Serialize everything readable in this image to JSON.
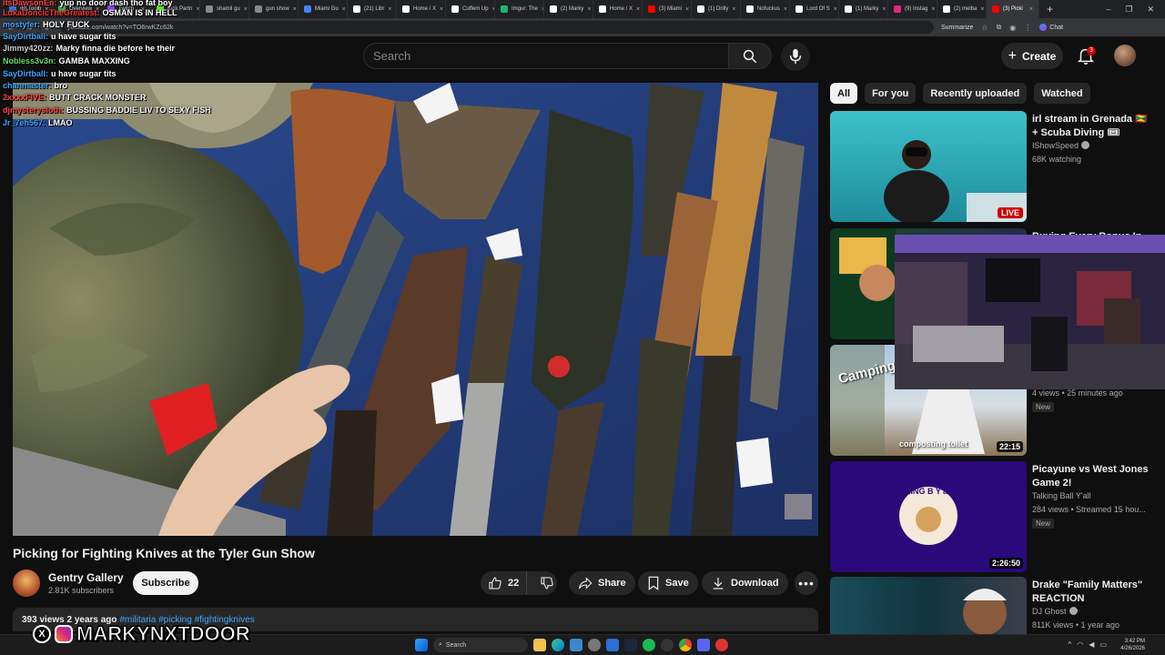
{
  "browser": {
    "tabs": [
      {
        "label": "IRLToolb",
        "color": "#3a7bd5"
      },
      {
        "label": "Overview",
        "color": "#4caf50"
      },
      {
        "label": "Twitch",
        "color": "#9146ff"
      },
      {
        "label": "Kick Partn",
        "color": "#53fc18"
      },
      {
        "label": "shamil gu",
        "color": "#888888"
      },
      {
        "label": "gun show",
        "color": "#888888"
      },
      {
        "label": "Miami Gu",
        "color": "#4285f4"
      },
      {
        "label": "(21) Libr",
        "color": "#ffffff"
      },
      {
        "label": "Home / X",
        "color": "#ffffff"
      },
      {
        "label": "Cuffem Up",
        "color": "#ffffff"
      },
      {
        "label": "Imgur: The",
        "color": "#1bb76e"
      },
      {
        "label": "(2) Marky",
        "color": "#ffffff"
      },
      {
        "label": "Home / X",
        "color": "#ffffff"
      },
      {
        "label": "(3) Miami",
        "color": "#ff0000"
      },
      {
        "label": "(1) Drilly",
        "color": "#ffffff"
      },
      {
        "label": "Nofuckus",
        "color": "#ffffff"
      },
      {
        "label": "Lord Of S",
        "color": "#ffffff"
      },
      {
        "label": "(1) Marky",
        "color": "#ffffff"
      },
      {
        "label": "(9) Instag",
        "color": "#dd2a7b"
      },
      {
        "label": "(2) melba",
        "color": "#ffffff"
      },
      {
        "label": "(3) Picki",
        "color": "#ff0000"
      }
    ],
    "url": "youtube.com/watch?v=TO6rwKZc62k",
    "summarize_label": "Summarize",
    "chat_label": "Chat"
  },
  "youtube": {
    "search_placeholder": "Search",
    "create_label": "Create",
    "notification_count": "3"
  },
  "chat": [
    {
      "user": "itsDawsonEn:",
      "msg": "yup no door dash tho fat boy",
      "color": "#ff4444"
    },
    {
      "user": "LukaDoncicTheGreatest:",
      "msg": "OSMAN IS IN HELL",
      "color": "#ff3333"
    },
    {
      "user": "mostyfer:",
      "msg": "HOLY FUCK",
      "color": "#3ea6ff"
    },
    {
      "user": "SayDirtball:",
      "msg": "u have sugar tits",
      "color": "#3ea6ff"
    },
    {
      "user": "Jimmy420zz:",
      "msg": "Marky finna die before he their",
      "color": "#cccccc"
    },
    {
      "user": "Nobless3v3n:",
      "msg": "GAMBA MAXXING",
      "color": "#66dd66"
    },
    {
      "user": "SayDirtball:",
      "msg": "u have sugar tits",
      "color": "#3ea6ff"
    },
    {
      "user": "chanmaster:",
      "msg": "bro",
      "color": "#3ea6ff"
    },
    {
      "user": "2xxxxFIVE:",
      "msg": "BUTT CRACK MONSTER",
      "color": "#ff4444"
    },
    {
      "user": "djmysterysloth:",
      "msg": "BUSSING BADDIE LIV TO SEXY FISH",
      "color": "#ff4444"
    },
    {
      "user": "Jr_7eh567:",
      "msg": "LMAO",
      "color": "#3ea6ff"
    }
  ],
  "video": {
    "title": "Picking for Fighting Knives at the Tyler Gun Show",
    "channel": "Gentry Gallery",
    "subscribers": "2.81K subscribers",
    "subscribe_label": "Subscribe",
    "likes": "22",
    "share_label": "Share",
    "save_label": "Save",
    "download_label": "Download",
    "description_meta": "393 views  2 years ago",
    "description_tags": "#militaria #picking #fightingknives"
  },
  "chips": [
    {
      "label": "All",
      "active": true
    },
    {
      "label": "For you",
      "active": false
    },
    {
      "label": "Recently uploaded",
      "active": false
    },
    {
      "label": "Watched",
      "active": false
    }
  ],
  "recommendations": [
    {
      "title": "irl stream in Grenada 🇬🇩 + Scuba Diving 🎟",
      "channel": "IShowSpeed",
      "meta": "68K watching",
      "badge": "LIVE"
    },
    {
      "title": "Buying Every Bonus In",
      "channel": "",
      "meta": "",
      "badge": ""
    },
    {
      "title": "",
      "channel": "",
      "meta": "4 views • 25 minutes ago",
      "badge": "22:15",
      "new": "New",
      "thumb_text": "Camping Box",
      "thumb_caption": "composting toilet"
    },
    {
      "title": "Picayune vs West Jones Game 2!",
      "channel": "Talking Ball Y'all",
      "meta": "284 views • Streamed 15 hou...",
      "badge": "2:26:50",
      "new": "New",
      "thumb_text": "KING B Y'all"
    },
    {
      "title": "Drake \"Family Matters\" REACTION",
      "channel": "DJ Ghost",
      "meta": "811K views • 1 year ago",
      "badge": ""
    }
  ],
  "watermark": {
    "text": "MARKYNXTDOOR"
  },
  "taskbar": {
    "search_label": "Search",
    "time": "3:42 PM",
    "date": "4/26/2026"
  },
  "colors": {
    "background": "#0f0f0f",
    "accent_red": "#cc0000",
    "chip_active": "#f1f1f1",
    "link_blue": "#3ea6ff"
  }
}
